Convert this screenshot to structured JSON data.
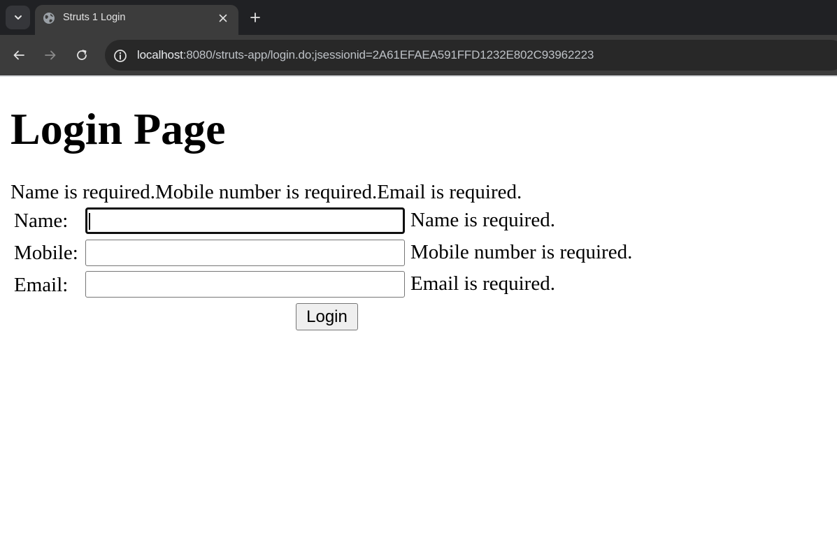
{
  "browser": {
    "tab": {
      "title": "Struts 1 Login",
      "favicon": "globe-icon",
      "close_icon": "close-icon"
    },
    "new_tab_icon": "plus-icon",
    "tab_search_icon": "chevron-down-icon",
    "nav": {
      "back_icon": "arrow-left-icon",
      "forward_icon": "arrow-right-icon",
      "reload_icon": "reload-icon"
    },
    "address_bar": {
      "site_info_icon": "info-icon",
      "host": "localhost",
      "rest": ":8080/struts-app/login.do;jsessionid=2A61EFAEA591FFD1232E802C93962223"
    },
    "colors": {
      "tabstrip": "#202124",
      "toolbar": "#3c3c3c",
      "omnibox": "#282828"
    }
  },
  "page": {
    "title": "Login Page",
    "errors_summary": "Name is required.Mobile number is required.Email is required.",
    "form": {
      "fields": [
        {
          "label": "Name:",
          "value": "",
          "error": "Name is required.",
          "focused": true
        },
        {
          "label": "Mobile:",
          "value": "",
          "error": "Mobile number is required.",
          "focused": false
        },
        {
          "label": "Email:",
          "value": "",
          "error": "Email is required.",
          "focused": false
        }
      ],
      "submit_label": "Login"
    }
  }
}
